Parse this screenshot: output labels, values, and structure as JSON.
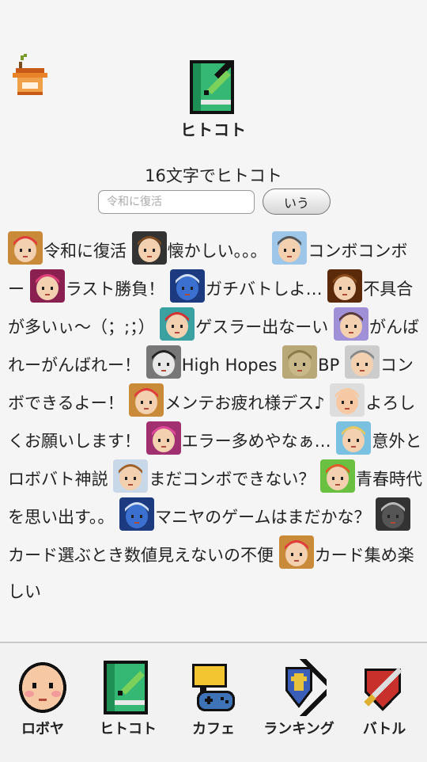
{
  "header": {
    "title": "ヒトコト"
  },
  "compose": {
    "prompt": "16文字でヒトコト",
    "placeholder": "令和に復活",
    "submit_label": "いう"
  },
  "feed": {
    "entries": [
      {
        "avatar": "girl-santa-hat-avatar",
        "text": "令和に復活"
      },
      {
        "avatar": "brown-hair-boy-avatar",
        "text": "懐かしい。。。"
      },
      {
        "avatar": "glasses-man-avatar",
        "text": "コンボコンボー"
      },
      {
        "avatar": "pink-hair-girl-avatar",
        "text": "ラスト勝負！"
      },
      {
        "avatar": "blue-robot-avatar",
        "text": "ガチバトしよ…"
      },
      {
        "avatar": "long-hair-girl-avatar",
        "text": "不具合が多いぃ〜（；;；）"
      },
      {
        "avatar": "red-cap-boy-avatar",
        "text": "ゲスラー出なーい"
      },
      {
        "avatar": "purple-girl-avatar",
        "text": "がんばれーがんばれー！"
      },
      {
        "avatar": "pale-figure-avatar",
        "text": "High Hopes"
      },
      {
        "avatar": "box-robot-avatar",
        "text": "BP"
      },
      {
        "avatar": "bald-man-avatar",
        "text": "コンボできるよー！"
      },
      {
        "avatar": "girl-santa-hat-avatar",
        "text": "メンテお疲れ様デス♪"
      },
      {
        "avatar": "bald-baby-avatar",
        "text": "よろしくお願いします！"
      },
      {
        "avatar": "pink-twin-girl-avatar",
        "text": "エラー多めやなぁ…"
      },
      {
        "avatar": "blonde-boy-avatar",
        "text": "意外とロボバト神説"
      },
      {
        "avatar": "brown-boy-avatar",
        "text": "まだコンボできない？"
      },
      {
        "avatar": "red-hair-girl-avatar",
        "text": "青春時代を思い出す。。"
      },
      {
        "avatar": "blue-robot-avatar",
        "text": "マニヤのゲームはまだかな？"
      },
      {
        "avatar": "grey-robot-avatar",
        "text": "カード選ぶとき数値見えないの不便"
      },
      {
        "avatar": "girl-santa-hat-avatar",
        "text": "カード集め楽しい"
      }
    ]
  },
  "tabs": [
    {
      "id": "robot",
      "label": "ロボヤ",
      "icon": "baby-face-icon"
    },
    {
      "id": "hitokoto",
      "label": "ヒトコト",
      "icon": "notebook-pencil-icon"
    },
    {
      "id": "cafe",
      "label": "カフェ",
      "icon": "cafe-icon"
    },
    {
      "id": "ranking",
      "label": "ランキング",
      "icon": "ranking-shield-icon"
    },
    {
      "id": "battle",
      "label": "バトル",
      "icon": "battle-shield-icon"
    }
  ],
  "colors": {
    "background": "#f5f5f5",
    "notebook_green": "#2fa86b",
    "home_orange": "#e8832a"
  }
}
